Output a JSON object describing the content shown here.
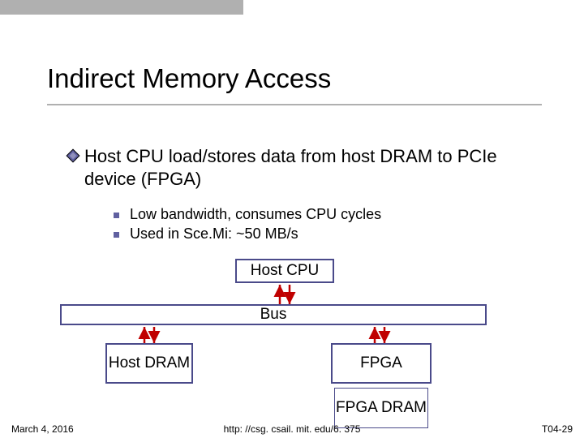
{
  "title": "Indirect Memory Access",
  "bullet_main": "Host CPU load/stores data from host DRAM to PCIe device (FPGA)",
  "sub_a": "Low bandwidth, consumes CPU cycles",
  "sub_b": "Used in Sce.Mi: ~50 MB/s",
  "box": {
    "hostcpu": "Host CPU",
    "bus": "Bus",
    "hostdram": "Host DRAM",
    "fpga": "FPGA",
    "fpgadram": "FPGA DRAM"
  },
  "footer": {
    "date": "March 4, 2016",
    "url": "http: //csg. csail. mit. edu/6. 375",
    "slide": "T04-29"
  },
  "colors": {
    "box_border": "#4a4a8a",
    "arrow": "#c00000",
    "accent": "#6060a0"
  }
}
